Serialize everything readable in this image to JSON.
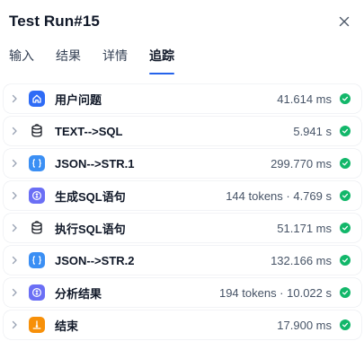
{
  "header": {
    "title": "Test Run#15",
    "close_icon": "close-icon"
  },
  "tabs": [
    {
      "label": "输入",
      "active": false
    },
    {
      "label": "结果",
      "active": false
    },
    {
      "label": "详情",
      "active": false
    },
    {
      "label": "追踪",
      "active": true
    }
  ],
  "colors": {
    "accent": "#2563eb",
    "success": "#12b76a"
  },
  "trace": [
    {
      "name": "用户问题",
      "metric": "41.614 ms",
      "icon": "home-icon",
      "status": "success"
    },
    {
      "name": "TEXT-->SQL",
      "metric": "5.941 s",
      "icon": "database-icon",
      "status": "success"
    },
    {
      "name": "JSON-->STR.1",
      "metric": "299.770 ms",
      "icon": "code-block-icon",
      "status": "success"
    },
    {
      "name": "生成SQL语句",
      "metric": "144 tokens · 4.769 s",
      "icon": "llm-icon",
      "status": "success"
    },
    {
      "name": "执行SQL语句",
      "metric": "51.171 ms",
      "icon": "database-icon",
      "status": "success"
    },
    {
      "name": "JSON-->STR.2",
      "metric": "132.166 ms",
      "icon": "code-block-icon",
      "status": "success"
    },
    {
      "name": "分析结果",
      "metric": "194 tokens · 10.022 s",
      "icon": "llm-icon",
      "status": "success"
    },
    {
      "name": "结束",
      "metric": "17.900 ms",
      "icon": "end-icon",
      "status": "success"
    }
  ]
}
